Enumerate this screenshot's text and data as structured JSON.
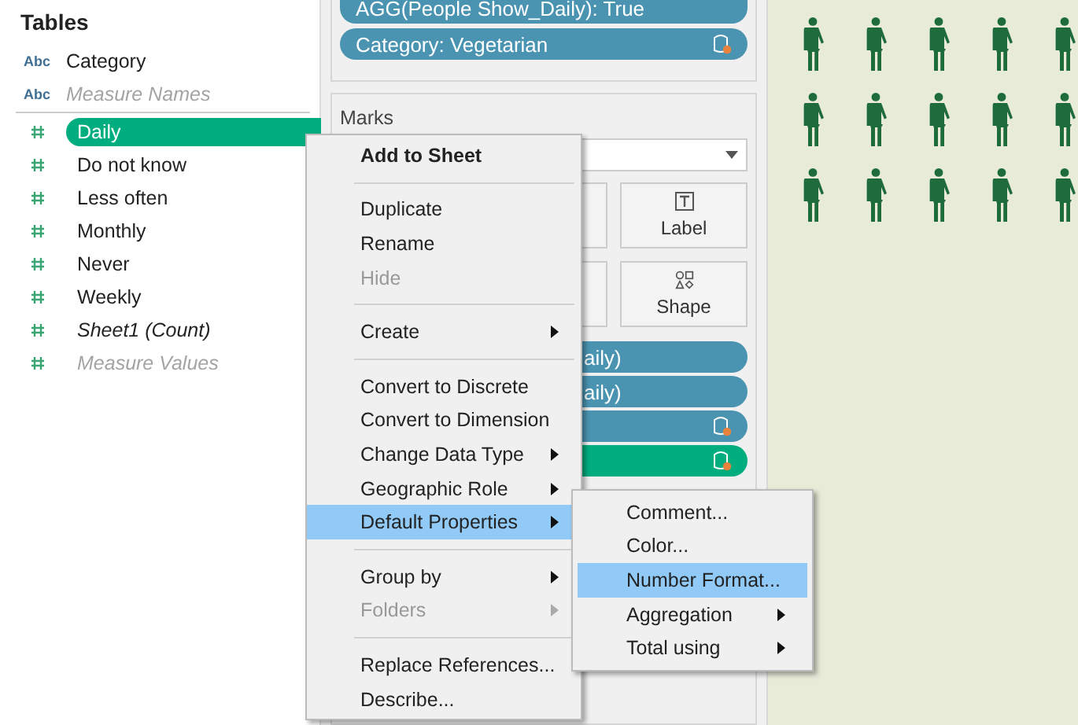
{
  "data_pane": {
    "title": "Tables",
    "fields": [
      {
        "label": "Category",
        "type_label": "Abc",
        "kind": "dimension",
        "italic": false,
        "disabled": false,
        "selected": false
      },
      {
        "label": "Measure Names",
        "type_label": "Abc",
        "kind": "dimension",
        "italic": true,
        "disabled": true,
        "selected": false
      },
      {
        "label": "Daily",
        "kind": "measure",
        "italic": false,
        "disabled": false,
        "selected": true
      },
      {
        "label": "Do not know",
        "kind": "measure",
        "italic": false,
        "disabled": false,
        "selected": false
      },
      {
        "label": "Less often",
        "kind": "measure",
        "italic": false,
        "disabled": false,
        "selected": false
      },
      {
        "label": "Monthly",
        "kind": "measure",
        "italic": false,
        "disabled": false,
        "selected": false
      },
      {
        "label": "Never",
        "kind": "measure",
        "italic": false,
        "disabled": false,
        "selected": false
      },
      {
        "label": "Weekly",
        "kind": "measure",
        "italic": false,
        "disabled": false,
        "selected": false
      },
      {
        "label": "Sheet1 (Count)",
        "kind": "measure",
        "italic": true,
        "disabled": false,
        "selected": false
      },
      {
        "label": "Measure Values",
        "kind": "measure",
        "italic": true,
        "disabled": true,
        "selected": false
      }
    ]
  },
  "filters": [
    {
      "label": "AGG(People Show_Daily): True",
      "kind": "dimension",
      "datasource": false
    },
    {
      "label": "Category: Vegetarian",
      "kind": "dimension",
      "datasource": true
    }
  ],
  "marks": {
    "title": "Marks",
    "buttons": [
      "Label",
      "Shape"
    ],
    "pills": [
      {
        "label": "aily)",
        "kind": "dimension",
        "datasource": false
      },
      {
        "label": "aily)",
        "kind": "dimension",
        "datasource": false
      },
      {
        "kind": "dimension",
        "datasource": true
      },
      {
        "kind": "measure",
        "datasource": true
      }
    ]
  },
  "context_menu": [
    {
      "kind": "item",
      "label": "Add to Sheet",
      "bold": true,
      "disabled": false,
      "submenu": false,
      "selected": false
    },
    {
      "kind": "separator"
    },
    {
      "kind": "item",
      "label": "Duplicate",
      "bold": false,
      "disabled": false,
      "submenu": false,
      "selected": false
    },
    {
      "kind": "item",
      "label": "Rename",
      "bold": false,
      "disabled": false,
      "submenu": false,
      "selected": false
    },
    {
      "kind": "item",
      "label": "Hide",
      "bold": false,
      "disabled": true,
      "submenu": false,
      "selected": false
    },
    {
      "kind": "separator"
    },
    {
      "kind": "item",
      "label": "Create",
      "bold": false,
      "disabled": false,
      "submenu": true,
      "selected": false
    },
    {
      "kind": "separator"
    },
    {
      "kind": "item",
      "label": "Convert to Discrete",
      "bold": false,
      "disabled": false,
      "submenu": false,
      "selected": false
    },
    {
      "kind": "item",
      "label": "Convert to Dimension",
      "bold": false,
      "disabled": false,
      "submenu": false,
      "selected": false
    },
    {
      "kind": "item",
      "label": "Change Data Type",
      "bold": false,
      "disabled": false,
      "submenu": true,
      "selected": false
    },
    {
      "kind": "item",
      "label": "Geographic Role",
      "bold": false,
      "disabled": false,
      "submenu": true,
      "selected": false
    },
    {
      "kind": "item",
      "label": "Default Properties",
      "bold": false,
      "disabled": false,
      "submenu": true,
      "selected": true
    },
    {
      "kind": "separator"
    },
    {
      "kind": "item",
      "label": "Group by",
      "bold": false,
      "disabled": false,
      "submenu": true,
      "selected": false
    },
    {
      "kind": "item",
      "label": "Folders",
      "bold": false,
      "disabled": true,
      "submenu": true,
      "selected": false
    },
    {
      "kind": "separator"
    },
    {
      "kind": "item",
      "label": "Replace References...",
      "bold": false,
      "disabled": false,
      "submenu": false,
      "selected": false
    },
    {
      "kind": "item",
      "label": "Describe...",
      "bold": false,
      "disabled": false,
      "submenu": false,
      "selected": false
    }
  ],
  "submenu": [
    {
      "label": "Comment...",
      "submenu": false,
      "selected": false
    },
    {
      "label": "Color...",
      "submenu": false,
      "selected": false
    },
    {
      "label": "Number Format...",
      "submenu": false,
      "selected": true
    },
    {
      "label": "Aggregation",
      "submenu": true,
      "selected": false
    },
    {
      "label": "Total using",
      "submenu": true,
      "selected": false
    }
  ]
}
